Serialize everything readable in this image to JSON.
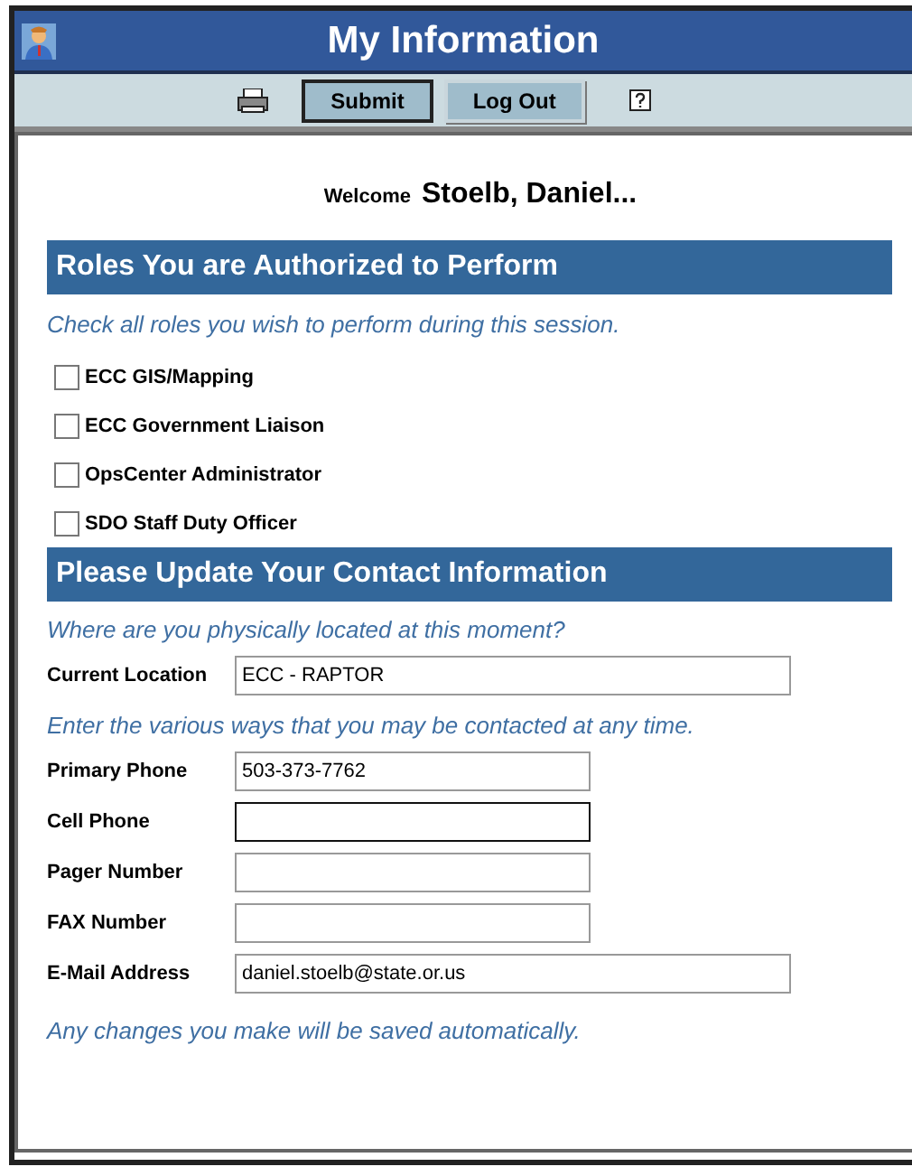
{
  "window": {
    "title": "My Information"
  },
  "toolbar": {
    "buttons": [
      {
        "label": "Submit",
        "default": true
      },
      {
        "label": "Log Out",
        "default": false
      }
    ]
  },
  "welcome": {
    "label": "Welcome",
    "name": "Stoelb, Daniel..."
  },
  "roles": {
    "heading": "Roles You are Authorized to Perform",
    "instruction": "Check all roles you wish to perform during this session.",
    "items": [
      {
        "label": "ECC GIS/Mapping",
        "checked": false
      },
      {
        "label": "ECC Government Liaison",
        "checked": false
      },
      {
        "label": "OpsCenter Administrator",
        "checked": false
      },
      {
        "label": "SDO Staff Duty Officer",
        "checked": false
      }
    ]
  },
  "contact": {
    "heading": "Please Update Your Contact Information",
    "location_question": "Where are you physically located at this moment?",
    "location": {
      "label": "Current Location",
      "value": "ECC - RAPTOR",
      "kind": "long",
      "focused": false
    },
    "instruction": "Enter the various ways that you may be contacted at any time.",
    "fields": [
      {
        "label": "Primary Phone",
        "value": "503-373-7762",
        "kind": "short",
        "focused": false
      },
      {
        "label": "Cell Phone",
        "kind": "short",
        "focused": true
      },
      {
        "label": "Pager Number",
        "kind": "short",
        "focused": false
      },
      {
        "label": "FAX Number",
        "kind": "short",
        "focused": false
      },
      {
        "label": "E-Mail Address",
        "value": "daniel.stoelb@state.or.us",
        "kind": "long",
        "focused": false
      }
    ],
    "footer": "Any changes you make will be saved automatically."
  }
}
